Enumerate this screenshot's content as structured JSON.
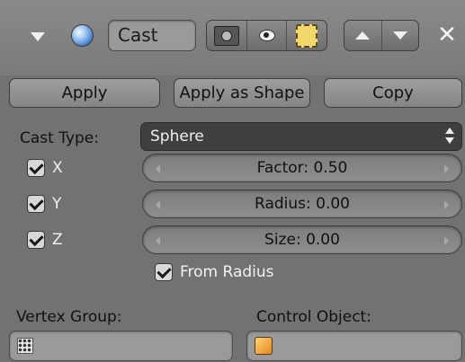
{
  "header": {
    "name": "Cast",
    "icons": [
      "collapse-triangle-icon",
      "cast-sphere-icon",
      "camera-render-icon",
      "eye-icon",
      "editmode-icon",
      "move-up-icon",
      "move-down-icon",
      "close-icon"
    ],
    "close_glyph": "✕"
  },
  "buttons": {
    "apply": "Apply",
    "apply_as_shape": "Apply as Shape",
    "copy": "Copy"
  },
  "cast_type": {
    "label": "Cast Type:",
    "value": "Sphere"
  },
  "axes": [
    {
      "label": "X",
      "checked": true
    },
    {
      "label": "Y",
      "checked": true
    },
    {
      "label": "Z",
      "checked": true
    }
  ],
  "sliders": {
    "factor": "Factor: 0.50",
    "radius": "Radius: 0.00",
    "size": "Size: 0.00"
  },
  "from_radius": {
    "label": "From Radius",
    "checked": true
  },
  "vertex_group": {
    "label": "Vertex Group:",
    "value": ""
  },
  "control_object": {
    "label": "Control Object:",
    "value": ""
  },
  "colors": {
    "panel_bg": "#727272",
    "dropdown_bg": "#3f3f3f",
    "slider_bg": "#868686"
  }
}
